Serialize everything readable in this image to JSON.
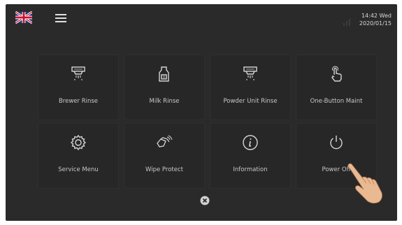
{
  "topbar": {
    "language_flag": "uk-flag-icon",
    "menu_icon": "hamburger-menu-icon",
    "time": "14:42 Wed",
    "date": "2020/01/15"
  },
  "tiles": [
    {
      "label": "Brewer Rinse",
      "icon": "brewer-rinse-icon"
    },
    {
      "label": "Milk Rinse",
      "icon": "milk-rinse-icon"
    },
    {
      "label": "Powder Unit Rinse",
      "icon": "powder-unit-rinse-icon"
    },
    {
      "label": "One-Button Maint",
      "icon": "touch-icon"
    },
    {
      "label": "Service Menu",
      "icon": "gear-icon"
    },
    {
      "label": "Wipe Protect",
      "icon": "wipe-hand-icon"
    },
    {
      "label": "Information",
      "icon": "info-icon"
    },
    {
      "label": "Power Off",
      "icon": "power-icon"
    }
  ],
  "close_icon": "close-icon",
  "colors": {
    "background": "#2a2a2a",
    "tile": "#272727",
    "text": "#c8c8c8"
  }
}
